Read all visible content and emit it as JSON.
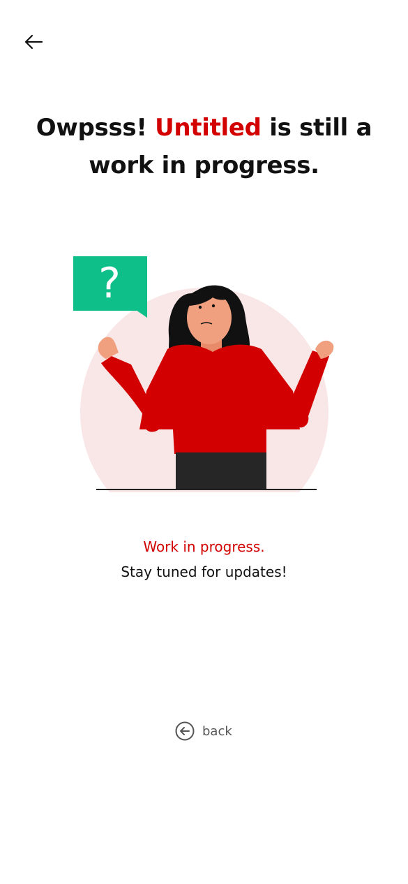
{
  "header": {
    "back_icon": "arrow-left-icon"
  },
  "headline": {
    "part1": "Owpsss! ",
    "app_name": "Untitled",
    "part2": " is still a work in progress."
  },
  "illustration": {
    "bubble_glyph": "?",
    "icon": "confused-person-illustration"
  },
  "status": {
    "title": "Work in progress.",
    "subtitle": "Stay tuned for updates!"
  },
  "footer": {
    "back_label": "back",
    "back_icon": "circle-arrow-left-icon"
  },
  "colors": {
    "accent": "#d20000",
    "bubble": "#0fbf8a",
    "circle": "#f9e6e7",
    "text": "#111111",
    "muted": "#555555"
  }
}
